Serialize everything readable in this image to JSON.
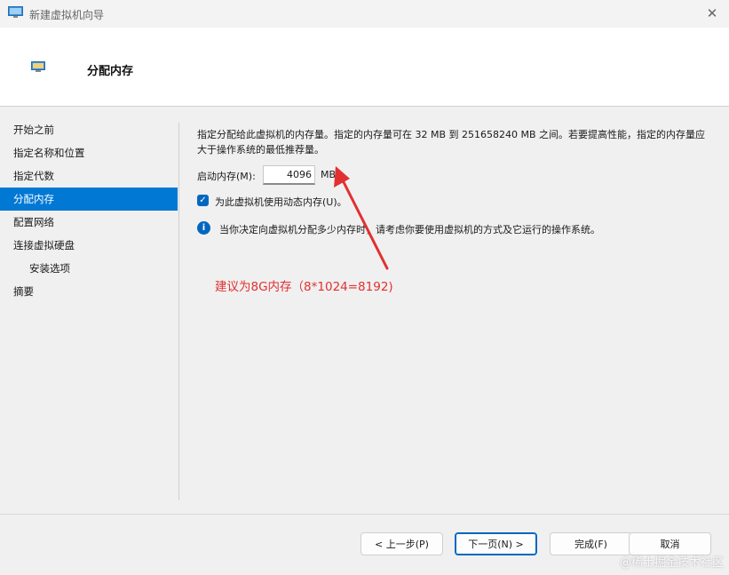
{
  "window": {
    "title": "新建虚拟机向导",
    "close_glyph": "✕"
  },
  "header": {
    "title": "分配内存",
    "icon": "vm-monitor-icon"
  },
  "sidebar": {
    "items": [
      {
        "label": "开始之前"
      },
      {
        "label": "指定名称和位置"
      },
      {
        "label": "指定代数"
      },
      {
        "label": "分配内存"
      },
      {
        "label": "配置网络"
      },
      {
        "label": "连接虚拟硬盘"
      },
      {
        "label": "安装选项"
      },
      {
        "label": "摘要"
      }
    ],
    "active": "分配内存"
  },
  "main": {
    "description": "指定分配给此虚拟机的内存量。指定的内存量可在 32 MB 到 251658240 MB 之间。若要提高性能，指定的内存量应大于操作系统的最低推荐量。",
    "memory_label": "启动内存(M):",
    "memory_value": "4096",
    "memory_unit": "MB",
    "dynamic_memory_label": "为此虚拟机使用动态内存(U)。",
    "dynamic_memory_checked": true,
    "info_text": "当你决定向虚拟机分配多少内存时，请考虑你要使用虚拟机的方式及它运行的操作系统。"
  },
  "annotation": {
    "text": "建议为8G内存（8*1024=8192)",
    "color": "#e23030"
  },
  "buttons": {
    "previous": "< 上一步(P)",
    "next": "下一页(N) >",
    "finish": "完成(F)",
    "cancel": "取消"
  },
  "watermark": "@稀土掘金技术社区",
  "colors": {
    "accent": "#0078d4"
  }
}
